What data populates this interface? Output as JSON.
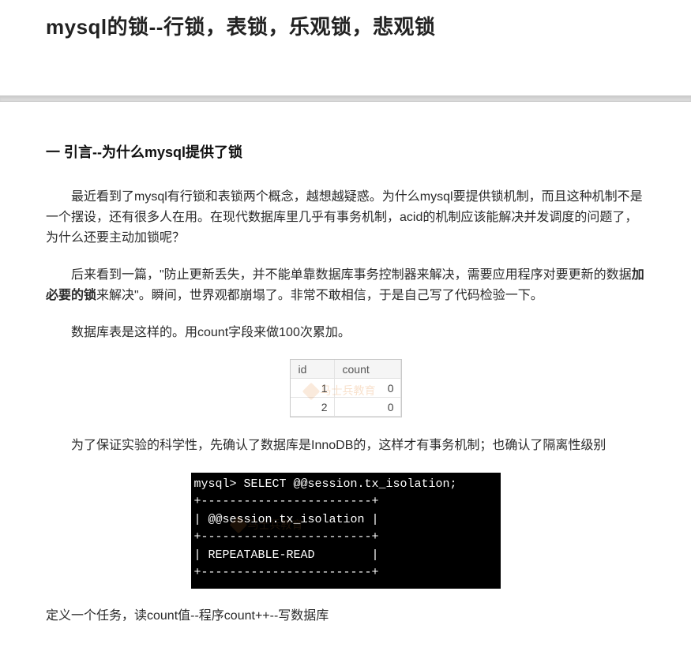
{
  "title": "mysql的锁--行锁，表锁，乐观锁，悲观锁",
  "section1_heading": "一 引言--为什么mysql提供了锁",
  "para1": "最近看到了mysql有行锁和表锁两个概念，越想越疑惑。为什么mysql要提供锁机制，而且这种机制不是一个摆设，还有很多人在用。在现代数据库里几乎有事务机制，acid的机制应该能解决并发调度的问题了，为什么还要主动加锁呢？",
  "para2_pre": "后来看到一篇，\"防止更新丢失，并不能单靠数据库事务控制器来解决，需要应用程序对要更新的数据",
  "para2_bold": "加必要的锁",
  "para2_post": "来解决\"。瞬间，世界观都崩塌了。非常不敢相信，于是自己写了代码检验一下。",
  "para3": "数据库表是这样的。用count字段来做100次累加。",
  "table": {
    "headers": {
      "id": "id",
      "count": "count"
    },
    "rows": [
      {
        "id": "1",
        "count": "0"
      },
      {
        "id": "2",
        "count": "0"
      }
    ]
  },
  "watermark_text": "马士兵教育",
  "para4": "为了保证实验的科学性，先确认了数据库是InnoDB的，这样才有事务机制；也确认了隔离性级别",
  "terminal": {
    "l0": "mysql> SELECT @@session.tx_isolation;",
    "l1": "+------------------------+",
    "l2": "| @@session.tx_isolation |",
    "l3": "+------------------------+",
    "l4": "| REPEATABLE-READ        |",
    "l5": "+------------------------+"
  },
  "para5": "定义一个任务，读count值--程序count++--写数据库"
}
